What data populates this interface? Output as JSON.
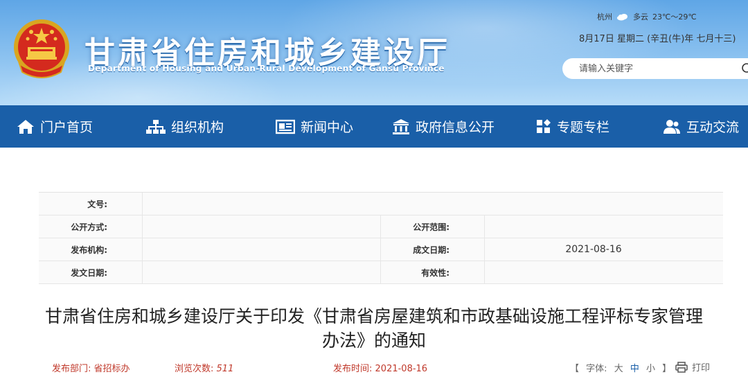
{
  "header": {
    "title": "甘肃省住房和城乡建设厅",
    "subtitle": "Department of Housing and Urban-Rural Development of Gansu Province",
    "weather": {
      "city": "杭州",
      "condition": "多云",
      "temp": "23℃～29℃"
    },
    "date": "8月17日   星期二    (辛丑(牛)年 七月十三)",
    "search_placeholder": "请输入关键字"
  },
  "nav": {
    "items": [
      {
        "label": "门户首页",
        "icon": "home-icon"
      },
      {
        "label": "组织机构",
        "icon": "org-chart-icon"
      },
      {
        "label": "新闻中心",
        "icon": "newspaper-icon"
      },
      {
        "label": "政府信息公开",
        "icon": "government-building-icon"
      },
      {
        "label": "专题专栏",
        "icon": "grid-icon"
      },
      {
        "label": "互动交流",
        "icon": "users-icon"
      }
    ]
  },
  "info": {
    "doc_no_label": "文号:",
    "doc_no_value": "",
    "disclosure_method_label": "公开方式:",
    "disclosure_method_value": "",
    "disclosure_scope_label": "公开范围:",
    "disclosure_scope_value": "",
    "issuer_label": "发布机构:",
    "issuer_value": "",
    "written_date_label": "成文日期:",
    "written_date_value": "2021-08-16",
    "issue_date_label": "发文日期:",
    "issue_date_value": "",
    "validity_label": "有效性:",
    "validity_value": ""
  },
  "article": {
    "title": "甘肃省住房和城乡建设厅关于印发《甘肃省房屋建筑和市政基础设施工程评标专家管理办法》的通知",
    "dept_label": "发布部门:",
    "dept_value": "省招标办",
    "views_label": "浏览次数:",
    "views_value": "511",
    "time_label": "发布时间:",
    "time_value": "2021-08-16",
    "font_open": "【",
    "font_label": "字体:",
    "font_large": "大",
    "font_medium": "中",
    "font_small": "小",
    "font_close": "】",
    "print_label": "打印"
  },
  "colors": {
    "nav_bg": "#1a5fa8",
    "meta_red": "#c0392b",
    "header_sky": "#7bb8ee"
  }
}
